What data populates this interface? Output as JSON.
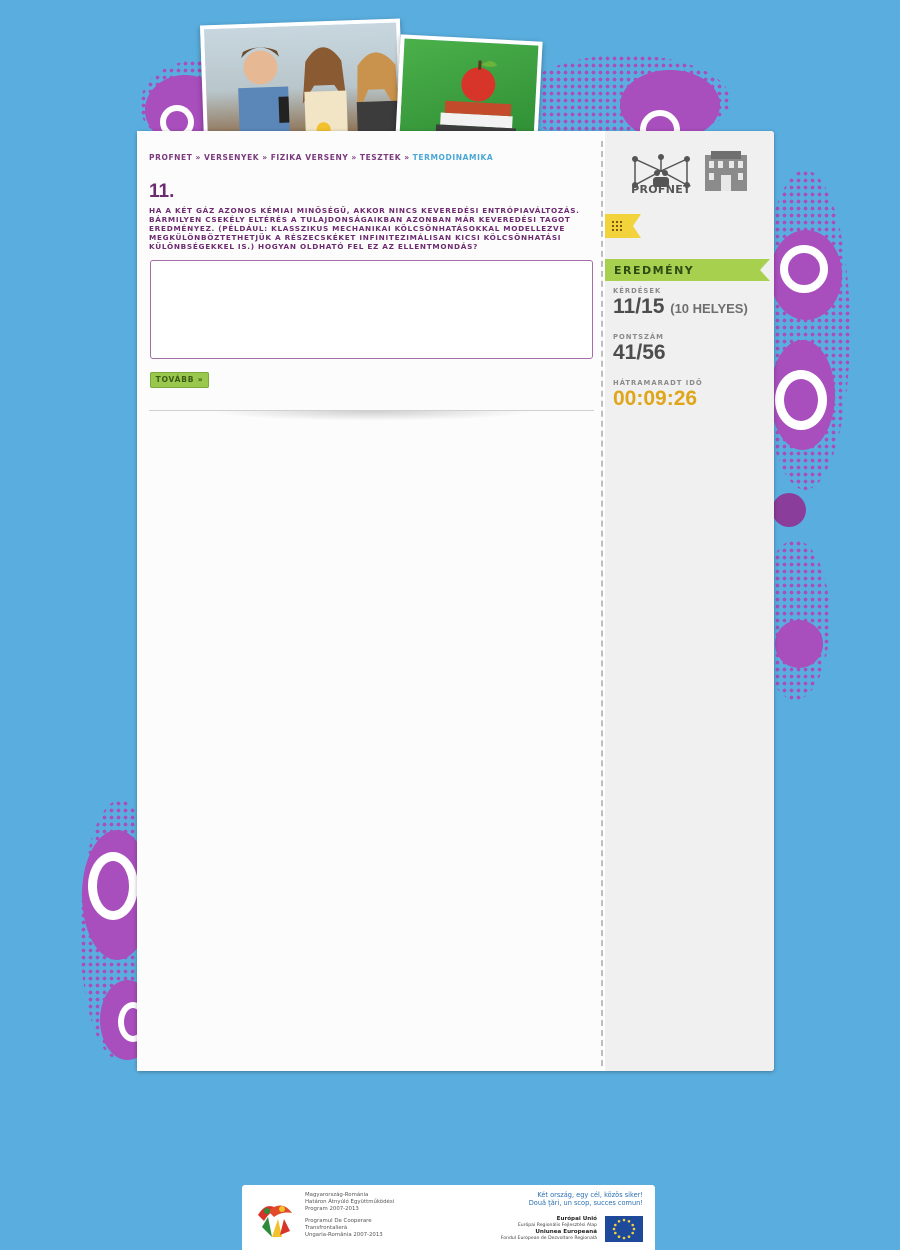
{
  "breadcrumb": [
    {
      "label": "PROFNET",
      "current": false
    },
    {
      "label": "VERSENYEK",
      "current": false
    },
    {
      "label": "FIZIKA VERSENY",
      "current": false
    },
    {
      "label": "TESZTEK",
      "current": false
    },
    {
      "label": "TERMODINAMIKA",
      "current": true
    }
  ],
  "breadcrumb_separator": "»",
  "question": {
    "number": "11.",
    "text": "HA A KÉT GÁZ AZONOS KÉMIAI MINŐSÉGŰ, AKKOR NINCS KEVEREDÉSI ENTRÓPIAVÁLTOZÁS. BÁRMILYEN CSEKÉLY ELTÉRÉS A TULAJDONSÁGAIKBAN AZONBAN MÁR KEVEREDÉSI TAGOT EREDMÉNYEZ. (PÉLDÁUL: KLASSZIKUS MECHANIKAI KÖLCSÖNHATÁSOKKAL MODELLEZVE MEGKÜLÖNBÖZTETHETJÜK A RÉSZECSKÉKET INFINITEZIMÁLISAN KICSI KÖLCSÖNHATÁSI KÜLÖNBSÉGEKKEL IS.) HOGYAN OLDHATÓ FEL EZ AZ ELLENTMONDÁS?",
    "answer_value": "",
    "next_label": "TOVÁBB »"
  },
  "sidebar": {
    "logo_label": "PROFNET",
    "result_title": "EREDMÉNY",
    "questions_label": "KÉRDÉSEK",
    "questions_value": "11/15",
    "questions_correct": "(10 HELYES)",
    "score_label": "PONTSZÁM",
    "score_value": "41/56",
    "time_label": "HÁTRAMARADT IDŐ",
    "time_value": "00:09:26"
  },
  "footer": {
    "program_hu": [
      "Magyarország-Románia",
      "Határon Átnyúló Együttműködési",
      "Program 2007-2013"
    ],
    "program_ro": [
      "Programul De Cooperare",
      "Transfrontalieră",
      "Ungaria-România 2007-2013"
    ],
    "slogan_hu": "Két ország, egy cél, közös siker!",
    "slogan_ro": "Două ţări, un scop, succes comun!",
    "eu_title": "Európai Unió",
    "eu_line1": "Európai Regionális Fejlesztési Alap",
    "eu_title_ro": "Uniunea Europeană",
    "eu_line2": "Fondul European de Dezvoltare Regională"
  },
  "colors": {
    "background": "#5aaedf",
    "accent_purple": "#6d2c70",
    "accent_green": "#a7d04f",
    "timer": "#e0a61a"
  },
  "icons": {
    "menu": "grid-icon",
    "logo": "profnet-network-icon",
    "building": "building-icon",
    "eu": "eu-flag-icon"
  }
}
